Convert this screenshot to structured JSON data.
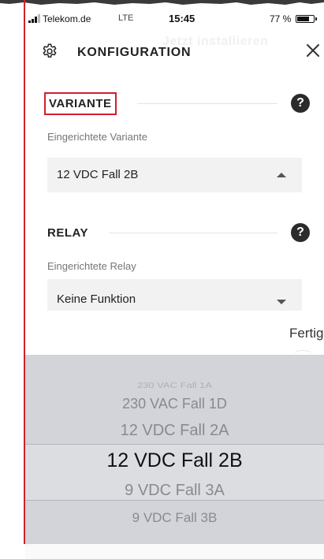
{
  "colors": {
    "accent": "#d0202f"
  },
  "status_bar": {
    "carrier": "Telekom.de",
    "network": "LTE",
    "time": "15:45",
    "battery_percent_text": "77 %",
    "battery_level": 0.77
  },
  "ghost_banner": "Jetzt installieren",
  "header": {
    "title": "KONFIGURATION",
    "settings_icon": "gear-icon",
    "close_icon": "close-icon",
    "close_symbol": "×"
  },
  "sections": {
    "variant": {
      "title": "VARIANTE",
      "help_symbol": "?",
      "field_label": "Eingerichtete Variante",
      "selected_value": "12 VDC Fall 2B"
    },
    "relay": {
      "title": "RELAY",
      "help_symbol": "?",
      "field_label": "Eingerichtete Relay",
      "selected_value": "Keine Funktion"
    }
  },
  "picker": {
    "done_label": "Fertig",
    "options": [
      "230 VAC Fall 1A",
      "230 VAC Fall 1D",
      "12 VDC Fall 2A",
      "12 VDC Fall 2B",
      "9 VDC Fall 3A",
      "9 VDC Fall 3B"
    ],
    "selected_option": "12 VDC Fall 2B"
  }
}
